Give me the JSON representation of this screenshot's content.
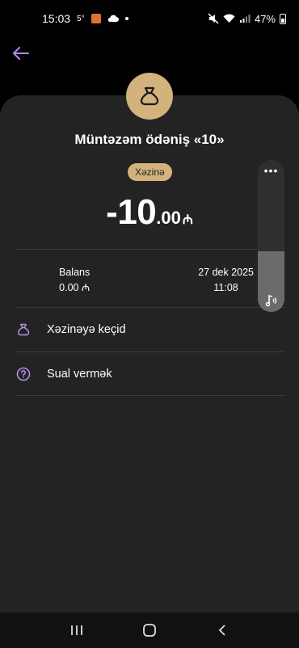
{
  "status_bar": {
    "time": "15:03",
    "temp": "5°",
    "battery": "47%"
  },
  "colors": {
    "accent": "#b38ae8",
    "gold": "#d3b27d",
    "card": "#232323"
  },
  "header": {
    "back_icon": "arrow-left-icon"
  },
  "transaction": {
    "icon": "money-bag-icon",
    "title": "Müntəzəm ödəniş «10»",
    "category": "Xəzinə",
    "amount_main": "-10",
    "amount_decimal": ".00",
    "currency": "₼"
  },
  "details": {
    "balance_label": "Balans",
    "balance_value": "0.00 ₼",
    "date": "27 dek 2025",
    "time": "11:08"
  },
  "actions": [
    {
      "label": "Xəzinəyə keçid",
      "icon": "money-bag-icon"
    },
    {
      "label": "Sual vermək",
      "icon": "question-circle-icon"
    }
  ],
  "volume_panel": {
    "more_label": "•••",
    "icon": "music-note-icon",
    "level_percent": 40
  },
  "nav_bar": {
    "recents_icon": "recents-icon",
    "home_icon": "home-icon",
    "back_icon": "chevron-left-icon"
  }
}
